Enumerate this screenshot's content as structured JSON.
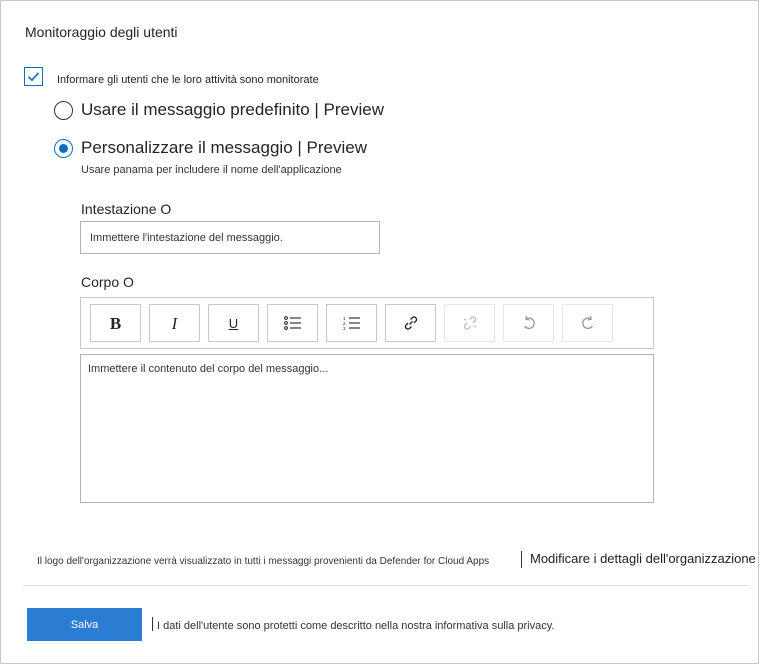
{
  "section": {
    "title": "Monitoraggio degli utenti"
  },
  "notify": {
    "checked": true,
    "label": "Informare gli utenti che le loro attività sono monitorate"
  },
  "message_options": [
    {
      "label": "Usare il messaggio predefinito",
      "tag": "Preview",
      "selected": false
    },
    {
      "label": "Personalizzare il messaggio",
      "tag": "Preview",
      "selected": true
    }
  ],
  "custom_hint": "Usare panama per includere il nome dell'applicazione",
  "header_field": {
    "label": "Intestazione O",
    "placeholder": "Immettere l'intestazione del messaggio."
  },
  "body_field": {
    "label": "Corpo O",
    "placeholder": "Immettere il contenuto del corpo del messaggio..."
  },
  "toolbar": {
    "bold": "B",
    "italic": "I",
    "underline": "U",
    "buttons": [
      "bold-icon",
      "italic-icon",
      "underline-icon",
      "bulleted-list-icon",
      "numbered-list-icon",
      "link-icon",
      "unlink-icon",
      "undo-icon",
      "redo-icon"
    ],
    "disabled": [
      "unlink-icon",
      "undo-icon",
      "redo-icon"
    ]
  },
  "footer": {
    "logo_note": "Il logo dell'organizzazione verrà visualizzato in tutti i messaggi provenienti da Defender for Cloud Apps",
    "edit_org_link": "Modificare i dettagli dell'organizzazione",
    "save_label": "Salva",
    "privacy_note": "I dati dell'utente sono protetti come descritto nella nostra informativa sulla privacy."
  },
  "colors": {
    "accent": "#0f6cbd",
    "button": "#2b7cd3",
    "border": "#c8c8c8"
  }
}
